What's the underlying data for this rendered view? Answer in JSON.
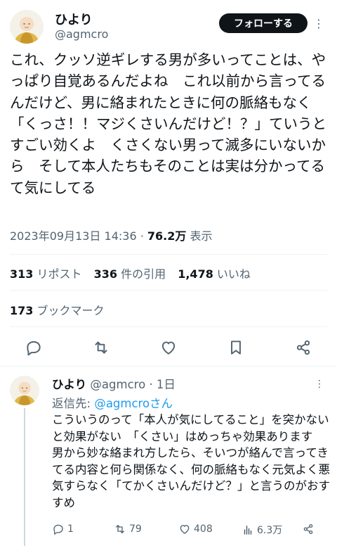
{
  "tweet": {
    "display_name": "ひより",
    "handle": "@agmcro",
    "follow_label": "フォローする",
    "more_label": "⋮",
    "text": "これ、クッソ逆ギレする男が多いってことは、やっぱり自覚あるんだよね　これ以前から言ってるんだけど、男に絡まれたときに何の脈絡もなく「くっさ！！マジくさいんだけど！？」ていうとすごい効くよ　くさくない男って滅多にいないから　そして本人たちもそのことは実は分かってるて気にしてる",
    "timestamp": "2023年09月13日 14:36",
    "separator": " · ",
    "views": "76.2万",
    "views_label": " 表示"
  },
  "stats": {
    "reposts": "313",
    "reposts_label": "リポスト",
    "quotes": "336",
    "quotes_label": "件の引用",
    "likes": "1,478",
    "likes_label": "いいね",
    "bookmarks": "173",
    "bookmarks_label": "ブックマーク"
  },
  "reply": {
    "display_name": "ひより",
    "handle": "@agmcro",
    "age": " · 1日",
    "more_label": "⋮",
    "reply_to_label": "返信先: ",
    "reply_to_mention": "@agmcroさん",
    "text": "こういうのって「本人が気にしてること」を突かないと効果がない　「くさい」はめっちゃ効果あります　男から妙な絡まれ方したら、そいつが絡んで言ってきてる内容と何ら関係なく、何の脈絡もなく元気よく悪気すらなく「てかくさいんだけど？」と言うのがおすすめ",
    "replies": "1",
    "reposts": "79",
    "likes": "408",
    "views": "6.3万"
  },
  "icons": {
    "reply": "reply-icon",
    "repost": "repost-icon",
    "like": "heart-icon",
    "bookmark": "bookmark-icon",
    "share": "share-icon",
    "views": "views-icon"
  }
}
